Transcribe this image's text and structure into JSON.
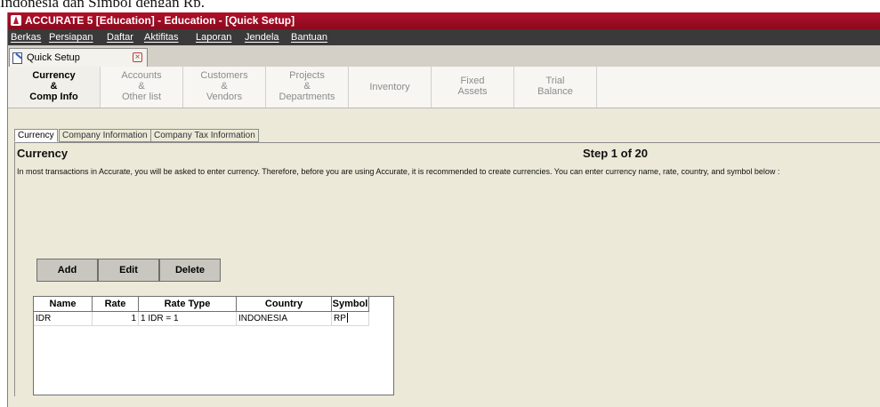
{
  "caption": "Indonesia dan Simbol dengan Rp.",
  "window": {
    "title": "ACCURATE 5 [Education] - Education - [Quick Setup]"
  },
  "menu": [
    "Berkas",
    "Persiapan",
    "Daftar",
    "Aktifitas",
    "Laporan",
    "Jendela",
    "Bantuan"
  ],
  "doc_tab": {
    "label": "Quick Setup"
  },
  "steps": [
    {
      "label": "Currency\n&\nComp Info",
      "active": true
    },
    {
      "label": "Accounts\n&\nOther list",
      "active": false
    },
    {
      "label": "Customers\n&\nVendors",
      "active": false
    },
    {
      "label": "Projects\n&\nDepartments",
      "active": false
    },
    {
      "label": "Inventory",
      "active": false
    },
    {
      "label": "Fixed\nAssets",
      "active": false
    },
    {
      "label": "Trial\nBalance",
      "active": false
    }
  ],
  "subtabs": [
    "Currency",
    "Company Information",
    "Company Tax Information"
  ],
  "panel": {
    "title": "Currency",
    "step_counter": "Step 1 of 20",
    "intro": "In most transactions in Accurate, you will be asked to enter currency. Therefore, before you are using Accurate, it is recommended to create currencies. You can enter currency name, rate, country, and symbol below :"
  },
  "buttons": {
    "add": "Add",
    "edit": "Edit",
    "delete": "Delete"
  },
  "table": {
    "columns": [
      "Name",
      "Rate",
      "Rate Type",
      "Country",
      "Symbol"
    ],
    "rows": [
      {
        "name": "IDR",
        "rate": "1",
        "rate_type": "1 IDR = 1",
        "country": "INDONESIA",
        "symbol": "RP"
      }
    ]
  }
}
